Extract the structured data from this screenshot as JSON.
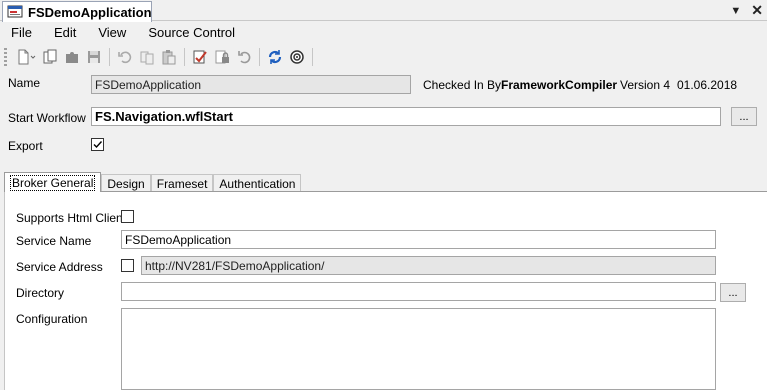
{
  "document_tab": {
    "title": "FSDemoApplication"
  },
  "window_controls": {
    "dropdown": "▼",
    "close": "✕"
  },
  "menu": [
    "File",
    "Edit",
    "View",
    "Source Control"
  ],
  "toolbar_icons": [
    "new-document-icon",
    "copy-document-icon",
    "puzzle-icon",
    "save-icon",
    "undo-icon",
    "copy-icon",
    "paste-icon",
    "check-in-icon",
    "lock-icon",
    "revert-icon",
    "refresh-icon",
    "settings-icon"
  ],
  "header": {
    "name_label": "Name",
    "name_value": "FSDemoApplication",
    "checked_in_by_label": "Checked In By",
    "checked_in_by_value": "FrameworkCompiler",
    "version": "Version 4",
    "date": "01.06.2018",
    "start_workflow_label": "Start Workflow",
    "start_workflow_value": "FS.Navigation.wflStart",
    "browse_label": "...",
    "export_label": "Export",
    "export_checked": true
  },
  "tabs": [
    "Broker General",
    "Design",
    "Frameset",
    "Authentication"
  ],
  "broker_general": {
    "supports_html_client_label": "Supports Html Client",
    "supports_html_client_checked": false,
    "service_name_label": "Service Name",
    "service_name_value": "FSDemoApplication",
    "service_address_label": "Service Address",
    "service_address_checked": false,
    "service_address_value": "http://NV281/FSDemoApplication/",
    "directory_label": "Directory",
    "directory_value": "",
    "directory_browse_label": "...",
    "configuration_label": "Configuration",
    "configuration_value": ""
  },
  "colors": {
    "background": "#f0f0f0",
    "readonly_field": "#e6e6e6",
    "accent_blue": "#1f5fbf"
  }
}
